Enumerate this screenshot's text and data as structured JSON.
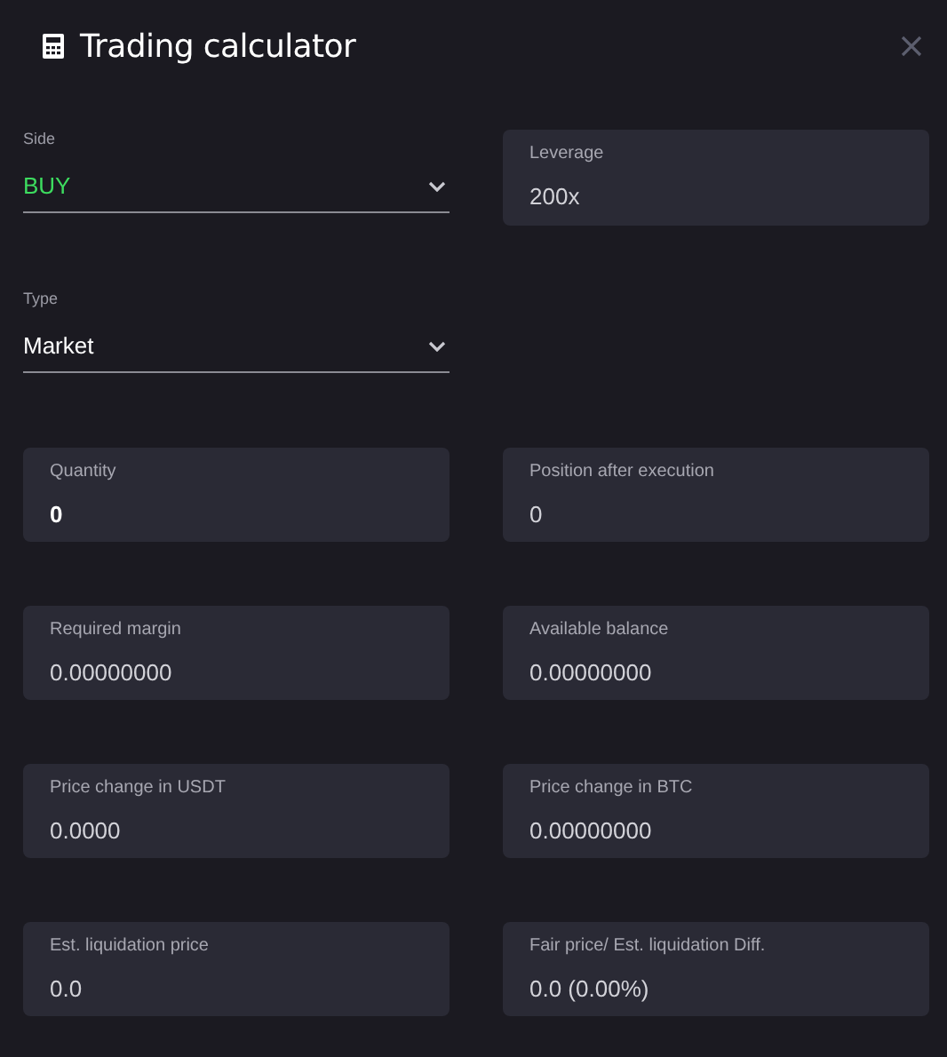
{
  "title": "Trading calculator",
  "selects": [
    {
      "label": "Side",
      "value": "BUY",
      "color": "#3ddc5f"
    },
    {
      "label": "Type",
      "value": "Market",
      "color": "#ffffff"
    }
  ],
  "leverage": {
    "label": "Leverage",
    "value": "200x"
  },
  "fields": [
    {
      "label": "Quantity",
      "value": "0",
      "kind": "input"
    },
    {
      "label": "Position after execution",
      "value": "0",
      "kind": "readonly"
    },
    {
      "label": "Required margin",
      "value": "0.00000000",
      "kind": "readonly"
    },
    {
      "label": "Available balance",
      "value": "0.00000000",
      "kind": "readonly"
    },
    {
      "label": "Price change in USDT",
      "value": "0.0000",
      "kind": "readonly"
    },
    {
      "label": "Price change in BTC",
      "value": "0.00000000",
      "kind": "readonly"
    },
    {
      "label": "Est. liquidation price",
      "value": "0.0",
      "kind": "readonly"
    },
    {
      "label": "Fair price/ Est. liquidation Diff.",
      "value": "0.0 (0.00%)",
      "kind": "readonly"
    }
  ]
}
